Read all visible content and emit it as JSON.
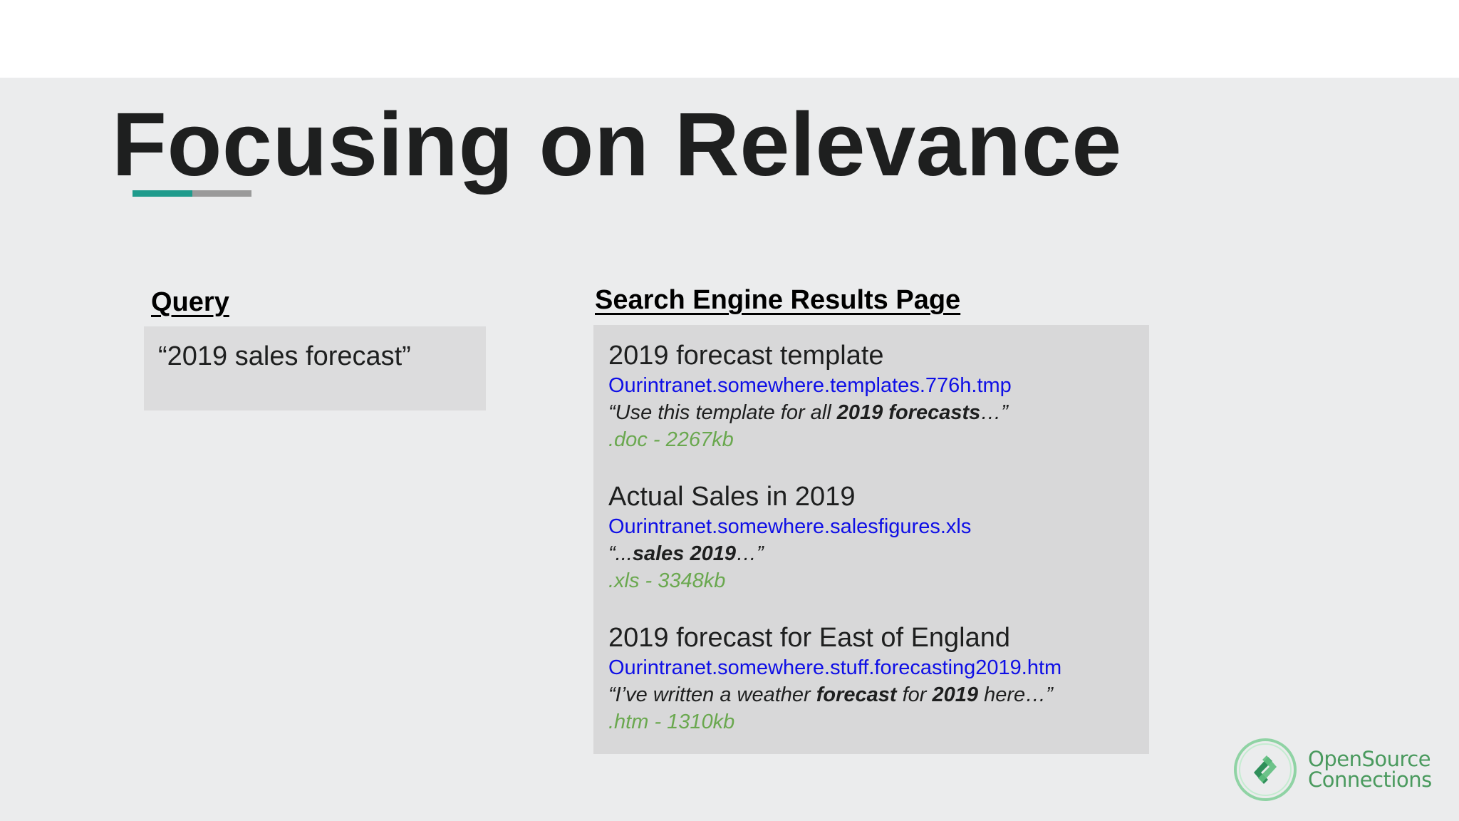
{
  "slide": {
    "title": "Focusing on Relevance"
  },
  "query": {
    "label": "Query",
    "text": "“2019 sales forecast”"
  },
  "serp": {
    "label": "Search Engine Results Page",
    "results": [
      {
        "title": "2019 forecast template",
        "url": "Ourintranet.somewhere.templates.776h.tmp",
        "snippet_parts": [
          {
            "text": "“Use this template for all ",
            "bold": false
          },
          {
            "text": "2019 forecasts",
            "bold": true
          },
          {
            "text": "…”",
            "bold": false
          }
        ],
        "meta": ".doc - 2267kb"
      },
      {
        "title": "Actual Sales in 2019",
        "url": "Ourintranet.somewhere.salesfigures.xls",
        "snippet_parts": [
          {
            "text": "“...",
            "bold": false
          },
          {
            "text": "sales 2019",
            "bold": true
          },
          {
            "text": "…”",
            "bold": false
          }
        ],
        "meta": ".xls - 3348kb"
      },
      {
        "title": "2019 forecast for East of England",
        "url": "Ourintranet.somewhere.stuff.forecasting2019.htm",
        "snippet_parts": [
          {
            "text": "“I’ve written a weather ",
            "bold": false
          },
          {
            "text": "forecast",
            "bold": true
          },
          {
            "text": " for ",
            "bold": false
          },
          {
            "text": "2019",
            "bold": true
          },
          {
            "text": " here…”",
            "bold": false
          }
        ],
        "meta": ".htm - 1310kb"
      }
    ]
  },
  "logo": {
    "line1": "OpenSource",
    "line2": "Connections",
    "icon": "opensource-connections-logo-icon"
  },
  "colors": {
    "background": "#ebeced",
    "title": "#1e1f1f",
    "accent_teal": "#1f9b8c",
    "accent_gray": "#9a9a9a",
    "url_blue": "#0f0fe6",
    "meta_green": "#6aa84f",
    "logo_green": "#4a9a5e"
  }
}
